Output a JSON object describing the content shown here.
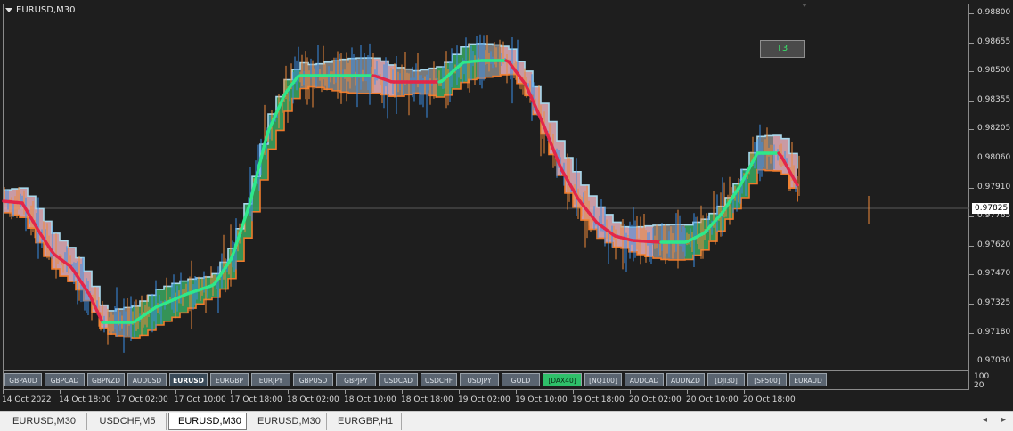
{
  "chart": {
    "title": "EURUSD,M30",
    "signal_label": "T3",
    "current_price": "0.97825"
  },
  "price_axis": [
    "0.98800",
    "0.98655",
    "0.98500",
    "0.98355",
    "0.98205",
    "0.98060",
    "0.97910",
    "0.97765",
    "0.97620",
    "0.97470",
    "0.97325",
    "0.97180",
    "0.97030"
  ],
  "indicator_axis": [
    "100",
    "20"
  ],
  "symbol_buttons": [
    {
      "label": "GBPAUD",
      "state": "normal"
    },
    {
      "label": "GBPCAD",
      "state": "normal"
    },
    {
      "label": "GBPNZD",
      "state": "normal"
    },
    {
      "label": "AUDUSD",
      "state": "normal"
    },
    {
      "label": "EURUSD",
      "state": "active"
    },
    {
      "label": "EURGBP",
      "state": "normal"
    },
    {
      "label": "EURJPY",
      "state": "normal"
    },
    {
      "label": "GBPUSD",
      "state": "normal"
    },
    {
      "label": "GBPJPY",
      "state": "normal"
    },
    {
      "label": "USDCAD",
      "state": "normal"
    },
    {
      "label": "USDCHF",
      "state": "normal"
    },
    {
      "label": "USDJPY",
      "state": "normal"
    },
    {
      "label": "GOLD",
      "state": "normal"
    },
    {
      "label": "[DAX40]",
      "state": "green"
    },
    {
      "label": "[NQ100]",
      "state": "normal"
    },
    {
      "label": "AUDCAD",
      "state": "normal"
    },
    {
      "label": "AUDNZD",
      "state": "normal"
    },
    {
      "label": "[DJI30]",
      "state": "normal"
    },
    {
      "label": "[SP500]",
      "state": "normal"
    },
    {
      "label": "EURAUD",
      "state": "normal"
    }
  ],
  "time_axis": [
    "14 Oct 2022",
    "14 Oct 18:00",
    "17 Oct 02:00",
    "17 Oct 10:00",
    "17 Oct 18:00",
    "18 Oct 02:00",
    "18 Oct 10:00",
    "18 Oct 18:00",
    "19 Oct 02:00",
    "19 Oct 10:00",
    "19 Oct 18:00",
    "20 Oct 02:00",
    "20 Oct 10:00",
    "20 Oct 18:00"
  ],
  "tabs": [
    "EURUSD,M30",
    "USDCHF,M5",
    "EURUSD,M30",
    "EURUSD,M30",
    "EURGBP,H1"
  ],
  "active_tab": 2,
  "colors": {
    "background": "#1e1e1e",
    "bull_line": "#2ee88a",
    "bear_line": "#e2264a",
    "band_up": "#3aa860",
    "band_down": "#e8b0bc",
    "band_neutral": "#8a8a8a",
    "upper_band": "#a8d8ec",
    "lower_band": "#f07a2a",
    "candle_up": "#3a8ee6",
    "candle_down": "#f08a3a"
  }
}
